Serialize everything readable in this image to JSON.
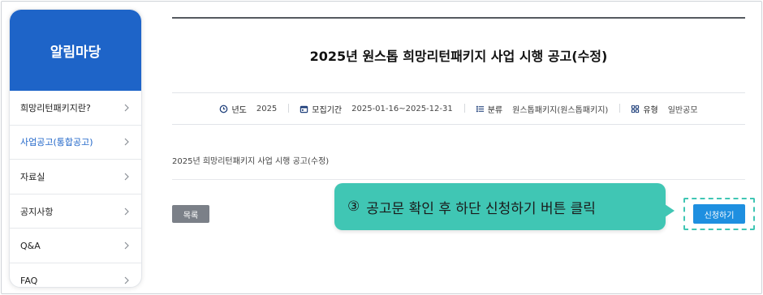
{
  "sidebar": {
    "title": "알림마당",
    "items": [
      {
        "label": "희망리턴패키지란?"
      },
      {
        "label": "사업공고(통합공고)"
      },
      {
        "label": "자료실"
      },
      {
        "label": "공지사항"
      },
      {
        "label": "Q&A"
      },
      {
        "label": "FAQ"
      }
    ],
    "active_item": "사업공고(통합공고)"
  },
  "notice": {
    "title": "2025년 원스톱 희망리턴패키지 사업 시행 공고(수정)",
    "meta": {
      "year_label": "년도",
      "year_value": "2025",
      "period_label": "모집기간",
      "period_value": "2025-01-16~2025-12-31",
      "category_label": "분류",
      "category_value": "원스톱패키지(원스톱패키지)",
      "type_label": "유형",
      "type_value": "일반공모"
    },
    "body": "2025년 희망리턴패키지 사업 시행 공고(수정)",
    "list_button": "목록",
    "apply_button": "신청하기"
  },
  "callout": {
    "number": "③",
    "text": "공고문 확인 후 하단 신청하기 버튼 클릭"
  },
  "colors": {
    "brand_blue": "#1e64c8",
    "apply_blue": "#1e8fe0",
    "callout_teal": "#40c6b4",
    "list_gray": "#7b8088"
  },
  "icons": [
    "clock-icon",
    "calendar-icon",
    "list-icon",
    "grid-icon",
    "chevron-right-icon"
  ]
}
